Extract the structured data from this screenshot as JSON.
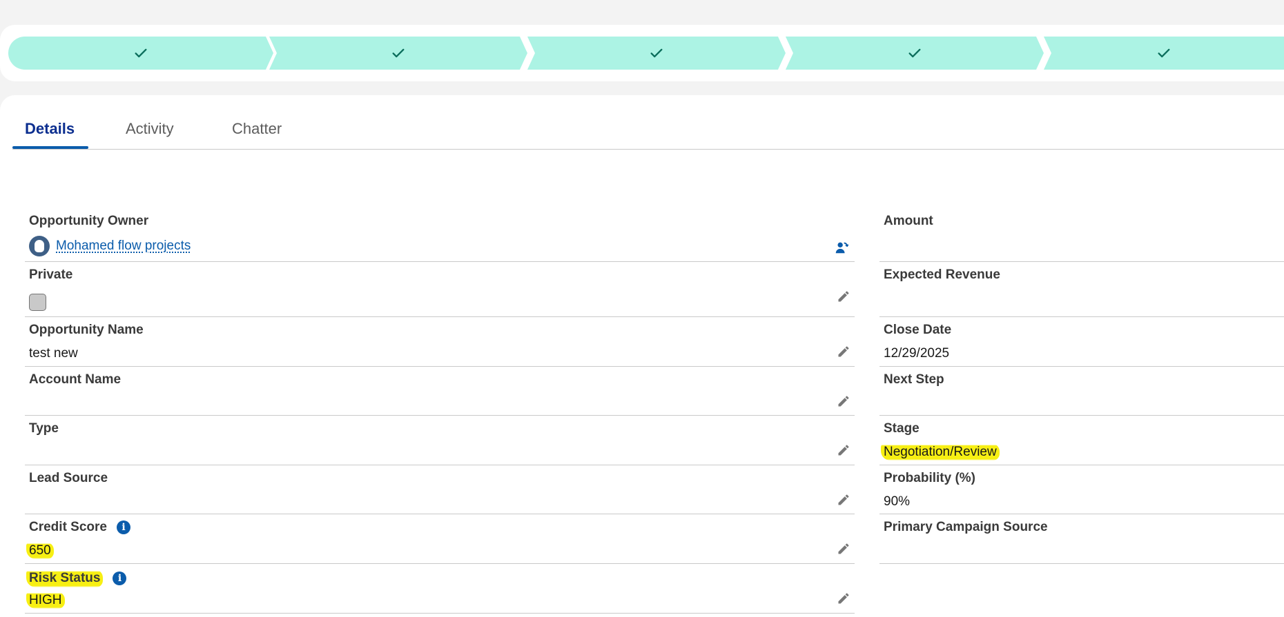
{
  "path": {
    "steps": [
      {
        "status": "complete",
        "icon": "check-icon"
      },
      {
        "status": "complete",
        "icon": "check-icon"
      },
      {
        "status": "complete",
        "icon": "check-icon"
      },
      {
        "status": "complete",
        "icon": "check-icon"
      },
      {
        "status": "complete",
        "icon": "check-icon"
      }
    ],
    "complete_color": "#acf3e4",
    "check_color": "#0b6e5c"
  },
  "tabs": [
    {
      "label": "Details",
      "active": true
    },
    {
      "label": "Activity",
      "active": false
    },
    {
      "label": "Chatter",
      "active": false
    }
  ],
  "details": {
    "left": [
      {
        "label": "Opportunity Owner",
        "value": "Mohamed flow projects",
        "type": "owner-link"
      },
      {
        "label": "Private",
        "value": "",
        "type": "checkbox",
        "checked": false
      },
      {
        "label": "Opportunity Name",
        "value": "test new"
      },
      {
        "label": "Account Name",
        "value": ""
      },
      {
        "label": "Type",
        "value": ""
      },
      {
        "label": "Lead Source",
        "value": ""
      },
      {
        "label": "Credit Score",
        "value": "650",
        "highlighted": true,
        "info": true
      },
      {
        "label": "Risk Status",
        "value": "HIGH",
        "highlighted": true,
        "info": true
      }
    ],
    "right": [
      {
        "label": "Amount",
        "value": ""
      },
      {
        "label": "Expected Revenue",
        "value": ""
      },
      {
        "label": "Close Date",
        "value": "12/29/2025"
      },
      {
        "label": "Next Step",
        "value": ""
      },
      {
        "label": "Stage",
        "value": "Negotiation/Review",
        "highlighted": true
      },
      {
        "label": "Probability (%)",
        "value": "90%"
      },
      {
        "label": "Primary Campaign Source",
        "value": ""
      }
    ]
  },
  "colors": {
    "link": "#0b5cab",
    "highlight": "#f7ef13",
    "active_tab": "#0b2e8f"
  }
}
